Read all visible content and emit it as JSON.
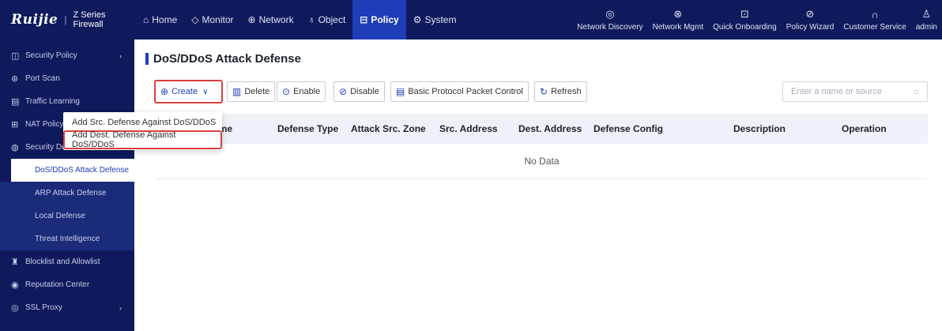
{
  "brand": {
    "logo": "Ruijie",
    "separator": "|",
    "subtitle": "Z Series Firewall"
  },
  "nav": [
    {
      "label": "Home",
      "icon": "home-icon",
      "glyph": "⌂",
      "active": false
    },
    {
      "label": "Monitor",
      "icon": "shield-icon",
      "glyph": "◇",
      "active": false
    },
    {
      "label": "Network",
      "icon": "globe-icon",
      "glyph": "⊕",
      "active": false
    },
    {
      "label": "Object",
      "icon": "object-icon",
      "glyph": "♁",
      "active": false
    },
    {
      "label": "Policy",
      "icon": "policy-icon",
      "glyph": "⊟",
      "active": true
    },
    {
      "label": "System",
      "icon": "gear-icon",
      "glyph": "⚙",
      "active": false
    }
  ],
  "tools": [
    {
      "label": "Network Discovery",
      "icon": "wifi-icon",
      "glyph": "◎"
    },
    {
      "label": "Network Mgmt",
      "icon": "network-mgmt-icon",
      "glyph": "⊗"
    },
    {
      "label": "Quick Onboarding",
      "icon": "onboarding-icon",
      "glyph": "⊡"
    },
    {
      "label": "Policy Wizard",
      "icon": "compass-icon",
      "glyph": "⊘"
    },
    {
      "label": "Customer Service",
      "icon": "headset-icon",
      "glyph": "∩"
    },
    {
      "label": "admin",
      "icon": "user-icon",
      "glyph": "♙"
    }
  ],
  "sidebar": {
    "items": [
      {
        "label": "Security Policy",
        "glyph": "◫"
      },
      {
        "label": "Port Scan",
        "glyph": "⊛"
      },
      {
        "label": "Traffic Learning",
        "glyph": "▤"
      },
      {
        "label": "NAT Policy",
        "glyph": "⊞"
      },
      {
        "label": "Security Defense",
        "glyph": "◍"
      },
      {
        "label": "Blocklist and Allowlist",
        "glyph": "♜"
      },
      {
        "label": "Reputation Center",
        "glyph": "◉"
      },
      {
        "label": "SSL Proxy",
        "glyph": "◎"
      }
    ],
    "sub_items": [
      {
        "label": "DoS/DDoS Attack Defense"
      },
      {
        "label": "ARP Attack Defense"
      },
      {
        "label": "Local Defense"
      },
      {
        "label": "Threat Intelligence"
      }
    ],
    "chevron": "›"
  },
  "page": {
    "title": "DoS/DDoS Attack Defense"
  },
  "toolbar": {
    "create": "Create",
    "delete": "Delete",
    "enable": "Enable",
    "disable": "Disable",
    "protocol": "Basic Protocol Packet Control",
    "refresh": "Refresh"
  },
  "search": {
    "placeholder": "Enter a name or source"
  },
  "dropdown": {
    "items": [
      "Add Src. Defense Against DoS/DDoS",
      "Add Dest. Defense Against DoS/DDoS"
    ]
  },
  "table": {
    "columns": [
      "ame",
      "Defense Type",
      "Attack Src. Zone",
      "Src. Address",
      "Dest. Address",
      "Defense Config",
      "Description",
      "Operation"
    ],
    "empty_text": "No Data"
  }
}
